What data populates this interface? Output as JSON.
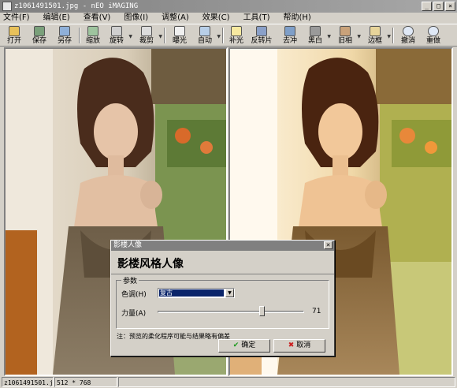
{
  "window": {
    "title": "z1061491501.jpg - nEO iMAGING"
  },
  "menu": [
    "文件(F)",
    "编辑(E)",
    "查看(V)",
    "图像(I)",
    "调整(A)",
    "效果(C)",
    "工具(T)",
    "帮助(H)"
  ],
  "toolbar": {
    "open": "打开",
    "save": "保存",
    "save_as": "另存",
    "resize": "缩放",
    "rotate": "旋转",
    "crop": "裁剪",
    "exposure": "曝光",
    "auto": "自动",
    "fill_light": "补光",
    "invert": "反转片",
    "sharpen": "去冲",
    "black_white": "黑白",
    "old_photo": "旧相",
    "border": "边框",
    "undo": "撤消",
    "redo": "重做"
  },
  "status": {
    "filename": "z1061491501.jpg",
    "dimensions": "512 * 768"
  },
  "dialog": {
    "title": "影楼人像",
    "heading": "影楼风格人像",
    "group_label": "参数",
    "tone_label": "色调(H)",
    "tone_value": "复古",
    "strength_label": "力量(A)",
    "strength_value": "71",
    "note": "注：预览的柔化程序可能与结果略有偏差",
    "ok": "确定",
    "cancel": "取消"
  },
  "colors": {
    "selection": "#0a246a",
    "ok_mark": "#1a9a1a",
    "cancel_mark": "#cc2020"
  },
  "icons": [
    "app-icon",
    "open-icon",
    "save-icon",
    "save-as-icon",
    "resize-icon",
    "rotate-icon",
    "crop-icon",
    "exposure-icon",
    "auto-icon",
    "fill-light-icon",
    "invert-icon",
    "sharpen-icon",
    "black-white-icon",
    "old-photo-icon",
    "border-icon",
    "undo-icon",
    "redo-icon",
    "check-icon",
    "close-x-icon"
  ]
}
